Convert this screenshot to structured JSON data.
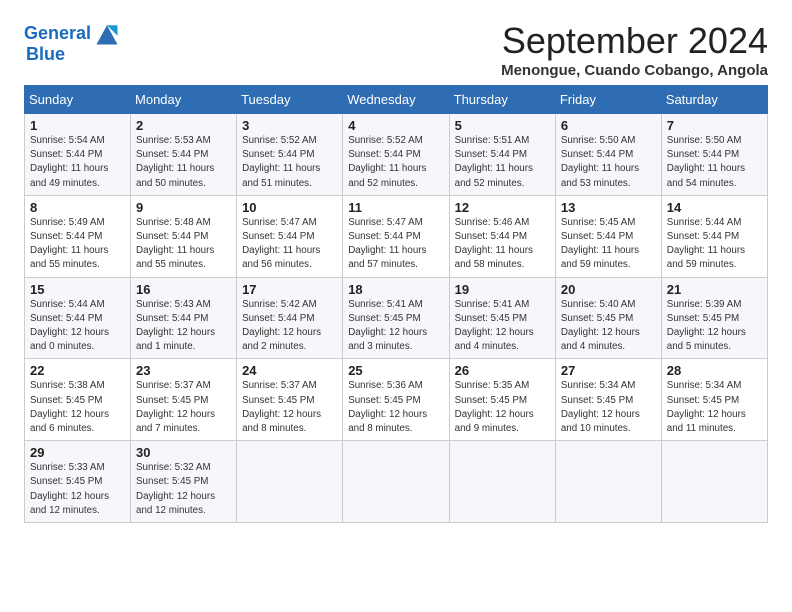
{
  "header": {
    "logo_line1": "General",
    "logo_line2": "Blue",
    "month": "September 2024",
    "location": "Menongue, Cuando Cobango, Angola"
  },
  "weekdays": [
    "Sunday",
    "Monday",
    "Tuesday",
    "Wednesday",
    "Thursday",
    "Friday",
    "Saturday"
  ],
  "weeks": [
    [
      {
        "day": "1",
        "sunrise": "5:54 AM",
        "sunset": "5:44 PM",
        "daylight": "11 hours and 49 minutes."
      },
      {
        "day": "2",
        "sunrise": "5:53 AM",
        "sunset": "5:44 PM",
        "daylight": "11 hours and 50 minutes."
      },
      {
        "day": "3",
        "sunrise": "5:52 AM",
        "sunset": "5:44 PM",
        "daylight": "11 hours and 51 minutes."
      },
      {
        "day": "4",
        "sunrise": "5:52 AM",
        "sunset": "5:44 PM",
        "daylight": "11 hours and 52 minutes."
      },
      {
        "day": "5",
        "sunrise": "5:51 AM",
        "sunset": "5:44 PM",
        "daylight": "11 hours and 52 minutes."
      },
      {
        "day": "6",
        "sunrise": "5:50 AM",
        "sunset": "5:44 PM",
        "daylight": "11 hours and 53 minutes."
      },
      {
        "day": "7",
        "sunrise": "5:50 AM",
        "sunset": "5:44 PM",
        "daylight": "11 hours and 54 minutes."
      }
    ],
    [
      {
        "day": "8",
        "sunrise": "5:49 AM",
        "sunset": "5:44 PM",
        "daylight": "11 hours and 55 minutes."
      },
      {
        "day": "9",
        "sunrise": "5:48 AM",
        "sunset": "5:44 PM",
        "daylight": "11 hours and 55 minutes."
      },
      {
        "day": "10",
        "sunrise": "5:47 AM",
        "sunset": "5:44 PM",
        "daylight": "11 hours and 56 minutes."
      },
      {
        "day": "11",
        "sunrise": "5:47 AM",
        "sunset": "5:44 PM",
        "daylight": "11 hours and 57 minutes."
      },
      {
        "day": "12",
        "sunrise": "5:46 AM",
        "sunset": "5:44 PM",
        "daylight": "11 hours and 58 minutes."
      },
      {
        "day": "13",
        "sunrise": "5:45 AM",
        "sunset": "5:44 PM",
        "daylight": "11 hours and 59 minutes."
      },
      {
        "day": "14",
        "sunrise": "5:44 AM",
        "sunset": "5:44 PM",
        "daylight": "11 hours and 59 minutes."
      }
    ],
    [
      {
        "day": "15",
        "sunrise": "5:44 AM",
        "sunset": "5:44 PM",
        "daylight": "12 hours and 0 minutes."
      },
      {
        "day": "16",
        "sunrise": "5:43 AM",
        "sunset": "5:44 PM",
        "daylight": "12 hours and 1 minute."
      },
      {
        "day": "17",
        "sunrise": "5:42 AM",
        "sunset": "5:44 PM",
        "daylight": "12 hours and 2 minutes."
      },
      {
        "day": "18",
        "sunrise": "5:41 AM",
        "sunset": "5:45 PM",
        "daylight": "12 hours and 3 minutes."
      },
      {
        "day": "19",
        "sunrise": "5:41 AM",
        "sunset": "5:45 PM",
        "daylight": "12 hours and 4 minutes."
      },
      {
        "day": "20",
        "sunrise": "5:40 AM",
        "sunset": "5:45 PM",
        "daylight": "12 hours and 4 minutes."
      },
      {
        "day": "21",
        "sunrise": "5:39 AM",
        "sunset": "5:45 PM",
        "daylight": "12 hours and 5 minutes."
      }
    ],
    [
      {
        "day": "22",
        "sunrise": "5:38 AM",
        "sunset": "5:45 PM",
        "daylight": "12 hours and 6 minutes."
      },
      {
        "day": "23",
        "sunrise": "5:37 AM",
        "sunset": "5:45 PM",
        "daylight": "12 hours and 7 minutes."
      },
      {
        "day": "24",
        "sunrise": "5:37 AM",
        "sunset": "5:45 PM",
        "daylight": "12 hours and 8 minutes."
      },
      {
        "day": "25",
        "sunrise": "5:36 AM",
        "sunset": "5:45 PM",
        "daylight": "12 hours and 8 minutes."
      },
      {
        "day": "26",
        "sunrise": "5:35 AM",
        "sunset": "5:45 PM",
        "daylight": "12 hours and 9 minutes."
      },
      {
        "day": "27",
        "sunrise": "5:34 AM",
        "sunset": "5:45 PM",
        "daylight": "12 hours and 10 minutes."
      },
      {
        "day": "28",
        "sunrise": "5:34 AM",
        "sunset": "5:45 PM",
        "daylight": "12 hours and 11 minutes."
      }
    ],
    [
      {
        "day": "29",
        "sunrise": "5:33 AM",
        "sunset": "5:45 PM",
        "daylight": "12 hours and 12 minutes."
      },
      {
        "day": "30",
        "sunrise": "5:32 AM",
        "sunset": "5:45 PM",
        "daylight": "12 hours and 12 minutes."
      },
      null,
      null,
      null,
      null,
      null
    ]
  ]
}
